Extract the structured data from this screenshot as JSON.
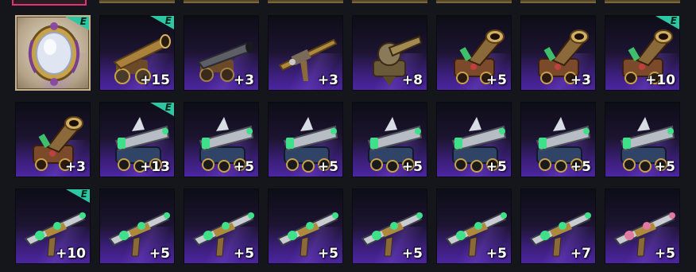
{
  "grid": {
    "rows": [
      [
        {
          "name": "ornate-mirror-item-icon",
          "kind": "mirror",
          "count": "",
          "badge": "E"
        },
        {
          "name": "bronze-cannon-item-icon",
          "kind": "cannon-bronze",
          "count": "+15",
          "badge": "E"
        },
        {
          "name": "iron-cannon-item-icon",
          "kind": "cannon-iron",
          "count": "+3",
          "badge": ""
        },
        {
          "name": "long-gun-item-icon",
          "kind": "long-gun",
          "count": "+3",
          "badge": ""
        },
        {
          "name": "blunderbuss-turret-item-icon",
          "kind": "turret",
          "count": "+8",
          "badge": ""
        },
        {
          "name": "mortar-cannon-item-icon",
          "kind": "mortar",
          "count": "+5",
          "badge": ""
        },
        {
          "name": "mortar-cannon-item-icon",
          "kind": "mortar",
          "count": "+3",
          "badge": ""
        },
        {
          "name": "mortar-cannon-item-icon",
          "kind": "mortar",
          "count": "+10",
          "badge": "E"
        }
      ],
      [
        {
          "name": "mortar-cannon-item-icon",
          "kind": "mortar",
          "count": "+3",
          "badge": ""
        },
        {
          "name": "shark-cannon-item-icon",
          "kind": "shark",
          "count": "+13",
          "badge": "E"
        },
        {
          "name": "shark-cannon-item-icon",
          "kind": "shark",
          "count": "+5",
          "badge": ""
        },
        {
          "name": "shark-cannon-item-icon",
          "kind": "shark",
          "count": "+5",
          "badge": ""
        },
        {
          "name": "shark-cannon-item-icon",
          "kind": "shark",
          "count": "+5",
          "badge": ""
        },
        {
          "name": "shark-cannon-item-icon",
          "kind": "shark",
          "count": "+5",
          "badge": ""
        },
        {
          "name": "shark-cannon-item-icon",
          "kind": "shark",
          "count": "+5",
          "badge": ""
        },
        {
          "name": "shark-cannon-item-icon",
          "kind": "shark",
          "count": "+5",
          "badge": ""
        }
      ],
      [
        {
          "name": "jade-rifle-item-icon",
          "kind": "rifle",
          "count": "+10",
          "badge": "E"
        },
        {
          "name": "jade-rifle-item-icon",
          "kind": "rifle",
          "count": "+5",
          "badge": ""
        },
        {
          "name": "jade-rifle-item-icon",
          "kind": "rifle",
          "count": "+5",
          "badge": ""
        },
        {
          "name": "jade-rifle-item-icon",
          "kind": "rifle",
          "count": "+5",
          "badge": ""
        },
        {
          "name": "jade-rifle-item-icon",
          "kind": "rifle",
          "count": "+5",
          "badge": ""
        },
        {
          "name": "jade-rifle-item-icon",
          "kind": "rifle",
          "count": "+5",
          "badge": ""
        },
        {
          "name": "jade-rifle-item-icon",
          "kind": "rifle",
          "count": "+7",
          "badge": ""
        },
        {
          "name": "pink-rifle-item-icon",
          "kind": "rifle-pink",
          "count": "+5",
          "badge": ""
        }
      ]
    ]
  },
  "colors": {
    "badge": "#2ec7a3",
    "slot_purple": "#4b25a0",
    "selected_border": "#e4307a",
    "gold_strip": "#8a7342"
  }
}
